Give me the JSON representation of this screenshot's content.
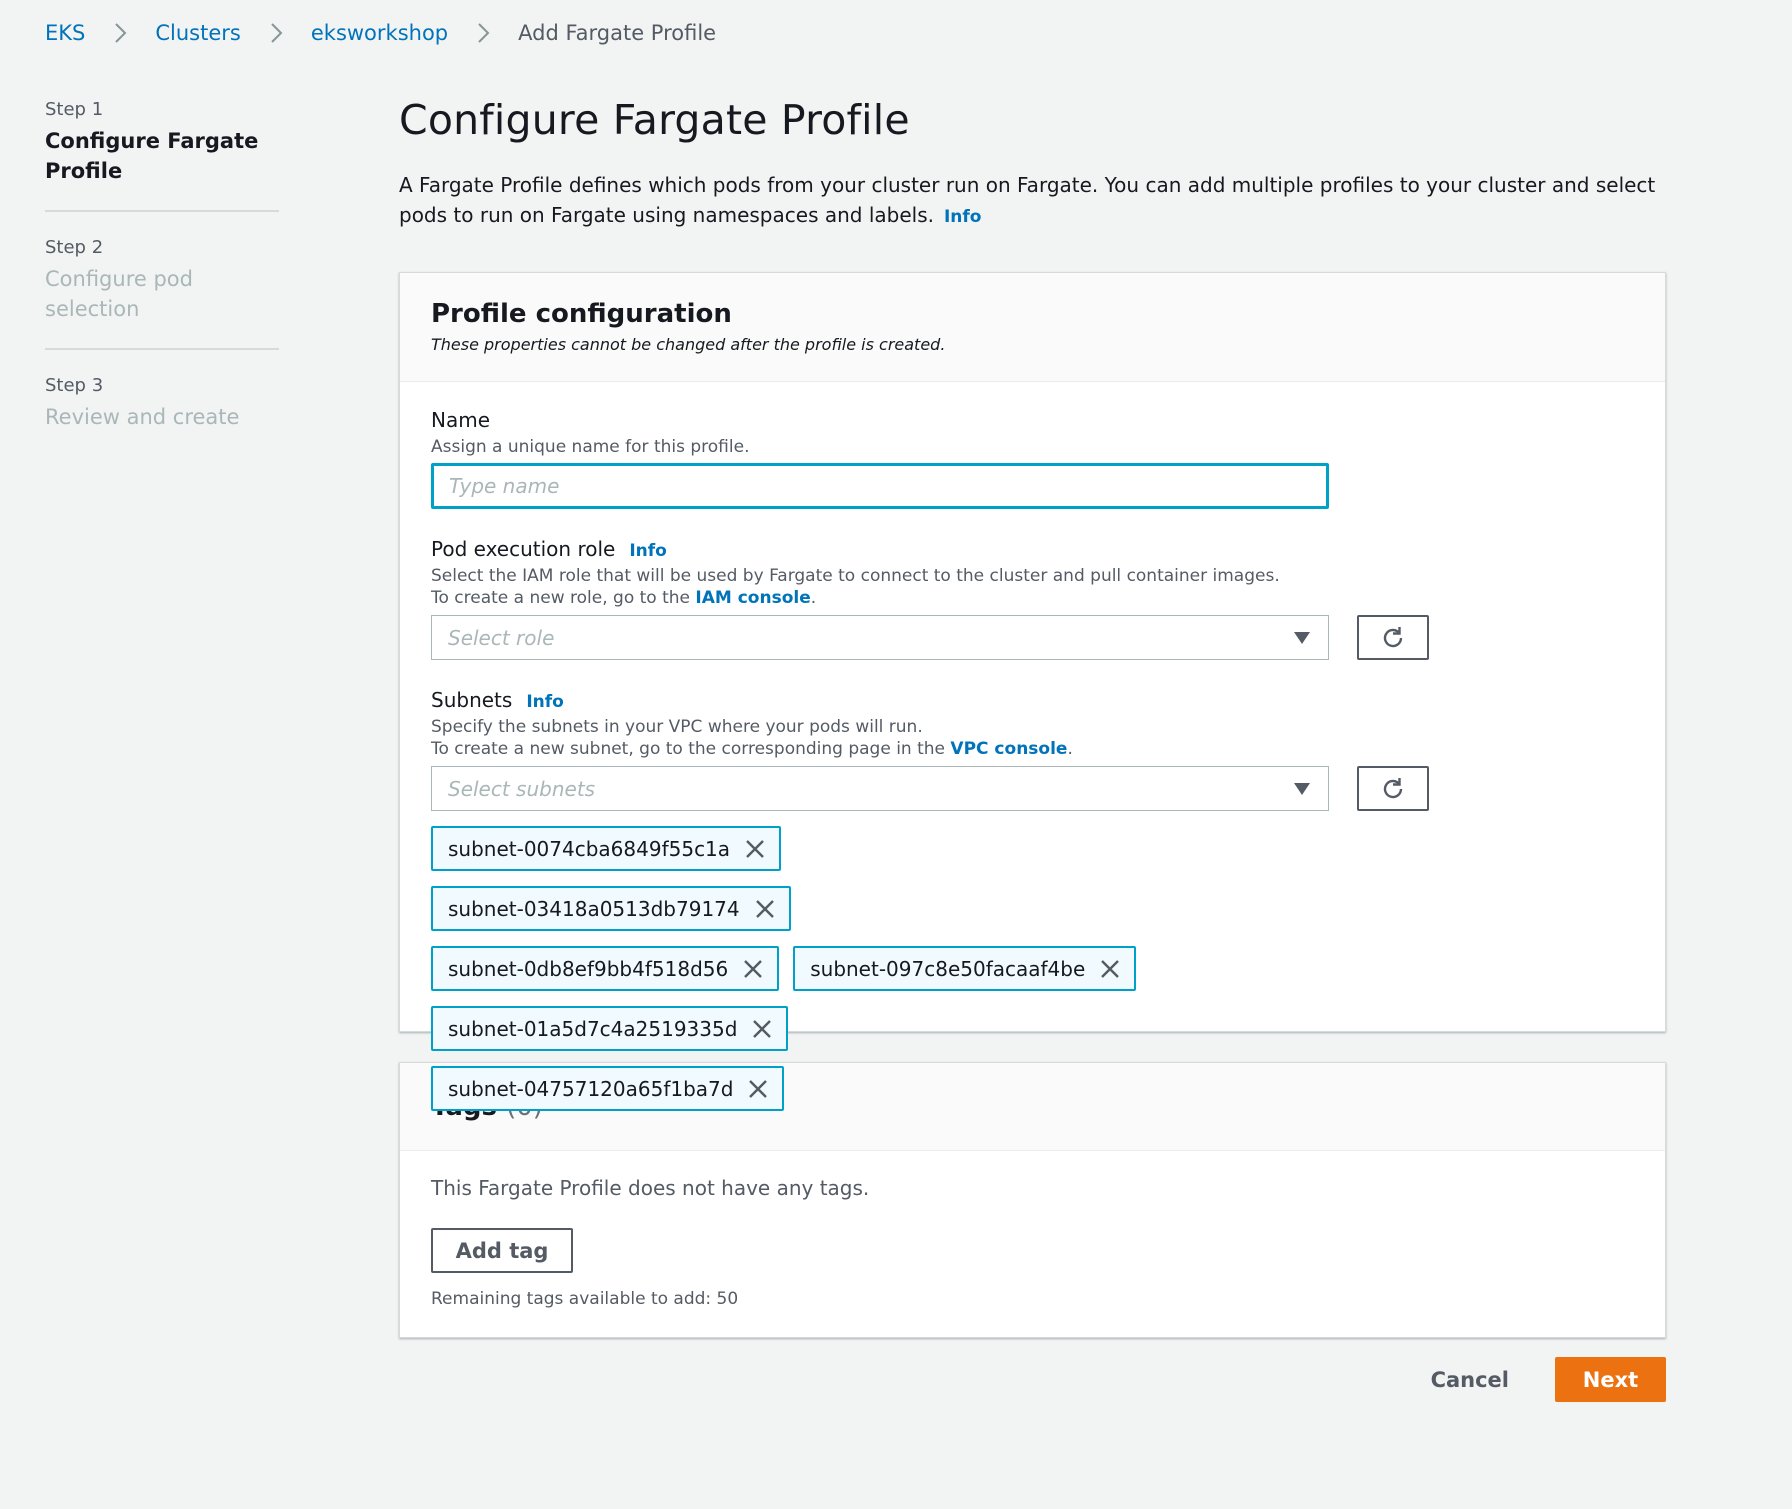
{
  "breadcrumb": {
    "items": [
      "EKS",
      "Clusters",
      "eksworkshop"
    ],
    "current": "Add Fargate Profile"
  },
  "steps": [
    {
      "num": "Step 1",
      "title": "Configure Fargate Profile"
    },
    {
      "num": "Step 2",
      "title": "Configure pod selection"
    },
    {
      "num": "Step 3",
      "title": "Review and create"
    }
  ],
  "page": {
    "title": "Configure Fargate Profile",
    "intro": "A Fargate Profile defines which pods from your cluster run on Fargate. You can add multiple profiles to your cluster and select pods to run on Fargate using namespaces and labels.",
    "info": "Info"
  },
  "profile_config": {
    "title": "Profile configuration",
    "subtitle": "These properties cannot be changed after the profile is created.",
    "name": {
      "label": "Name",
      "desc": "Assign a unique name for this profile.",
      "placeholder": "Type name",
      "value": ""
    },
    "role": {
      "label": "Pod execution role",
      "info": "Info",
      "desc1": "Select the IAM role that will be used by Fargate to connect to the cluster and pull container images.",
      "desc2_pre": "To create a new role, go to the ",
      "desc2_link": "IAM console",
      "desc2_post": ".",
      "placeholder": "Select role"
    },
    "subnets": {
      "label": "Subnets",
      "info": "Info",
      "desc1": "Specify the subnets in your VPC where your pods will run.",
      "desc2_pre": "To create a new subnet, go to the corresponding page in the ",
      "desc2_link": "VPC console",
      "desc2_post": ".",
      "placeholder": "Select subnets",
      "selected": [
        "subnet-0074cba6849f55c1a",
        "subnet-03418a0513db79174",
        "subnet-0db8ef9bb4f518d56",
        "subnet-097c8e50facaaf4be",
        "subnet-01a5d7c4a2519335d",
        "subnet-04757120a65f1ba7d"
      ]
    }
  },
  "tags": {
    "title": "Tags",
    "count": "(0)",
    "empty": "This Fargate Profile does not have any tags.",
    "add_label": "Add tag",
    "remaining": "Remaining tags available to add: 50"
  },
  "actions": {
    "cancel": "Cancel",
    "next": "Next"
  },
  "colors": {
    "link": "#0073bb",
    "focus": "#00a1c9",
    "primary": "#ec7211",
    "background": "#f2f3f3"
  }
}
